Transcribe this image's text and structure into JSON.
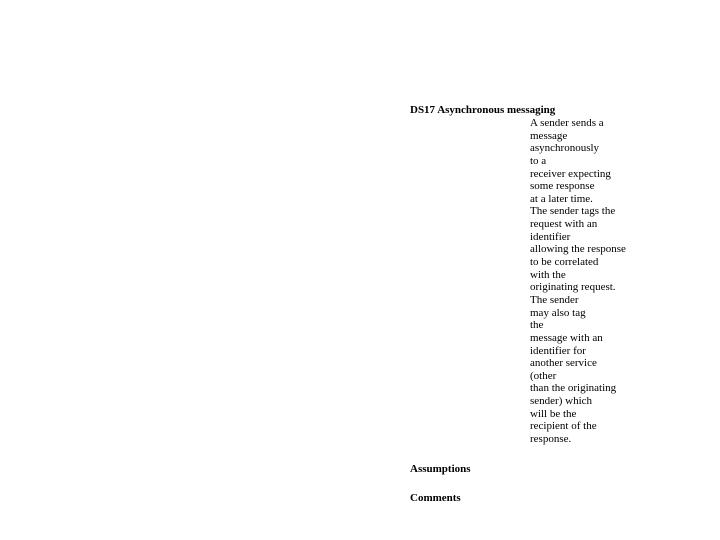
{
  "heading_main": "DS17 Asynchronous messaging",
  "body": {
    "l1": "A sender sends a",
    "l2": "message",
    "l3": "asynchronously",
    "l4": "to a",
    "l5": "receiver expecting",
    "l6": "some response",
    "l7": "at a later time.",
    "l8": "The sender tags the",
    "l9": "request with an",
    "l10": "identifier",
    "l11": "allowing the response",
    "l12": "to be correlated",
    "l13": "with the",
    "l14": "originating request.",
    "l15": "The sender",
    "l16": "may also tag",
    "l17": "the",
    "l18": "message with an",
    "l19": "identifier for",
    "l20": "another service",
    "l21": "(other",
    "l22": "than the originating",
    "l23": "sender) which",
    "l24": "will be the",
    "l25": "recipient of the",
    "l26": "response."
  },
  "heading_assumptions": "Assumptions",
  "heading_comments": "Comments"
}
